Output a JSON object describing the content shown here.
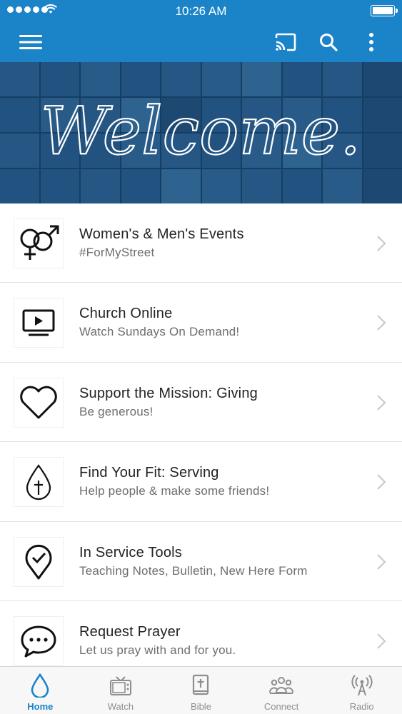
{
  "status_bar": {
    "time": "10:26 AM",
    "signal_icon": "signal-dots-icon",
    "wifi_icon": "wifi-icon",
    "battery_icon": "battery-icon"
  },
  "nav_bar": {
    "menu_icon": "hamburger-menu-icon",
    "cast_icon": "cast-icon",
    "search_icon": "search-icon",
    "more_icon": "more-vertical-icon"
  },
  "hero": {
    "welcome_text": "Welcome."
  },
  "list": [
    {
      "icon": "gender-symbols-icon",
      "title": "Women's & Men's Events",
      "subtitle": "#ForMyStreet"
    },
    {
      "icon": "tv-play-icon",
      "title": "Church Online",
      "subtitle": "Watch Sundays On Demand!"
    },
    {
      "icon": "heart-icon",
      "title": "Support the Mission: Giving",
      "subtitle": "Be generous!"
    },
    {
      "icon": "drop-cross-icon",
      "title": "Find Your Fit: Serving",
      "subtitle": "Help people & make some friends!"
    },
    {
      "icon": "location-check-icon",
      "title": "In Service Tools",
      "subtitle": "Teaching Notes, Bulletin, New Here Form"
    },
    {
      "icon": "chat-bubble-icon",
      "title": "Request Prayer",
      "subtitle": "Let us pray with and for you."
    }
  ],
  "tabs": [
    {
      "label": "Home",
      "icon": "drop-icon",
      "active": true
    },
    {
      "label": "Watch",
      "icon": "tv-icon",
      "active": false
    },
    {
      "label": "Bible",
      "icon": "bible-icon",
      "active": false
    },
    {
      "label": "Connect",
      "icon": "people-icon",
      "active": false
    },
    {
      "label": "Radio",
      "icon": "radio-tower-icon",
      "active": false
    }
  ],
  "colors": {
    "accent": "#1b84c9",
    "tab_inactive": "#8e8e8e",
    "title_text": "#222222",
    "subtitle_text": "#6d6d6d"
  }
}
